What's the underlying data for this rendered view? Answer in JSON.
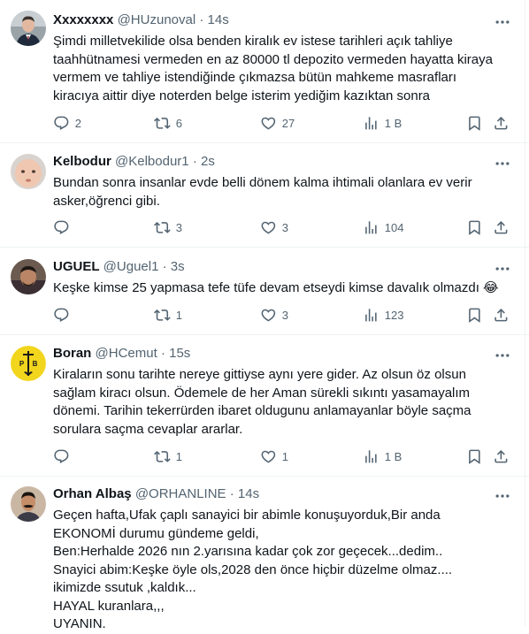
{
  "tweets": [
    {
      "name": "Xxxxxxxx",
      "handle": "@HUzunoval",
      "separator": "·",
      "time": "14s",
      "lines": [
        "Şimdi milletvekilide olsa benden kiralık ev istese tarihleri açık tahliye",
        "taahhütnamesi vermeden en az 80000 tl depozito vermeden hayatta kiraya",
        "vermem ve tahliye istendiğinde çıkmazsa bütün mahkeme masrafları",
        "kiracıya aittir diye noterden belge isterim yediğim kazıktan sonra"
      ],
      "replies": "2",
      "retweets": "6",
      "likes": "27",
      "views": "1 B",
      "avatar": "man-in-suit"
    },
    {
      "name": "Kelbodur",
      "handle": "@Kelbodur1",
      "separator": "·",
      "time": "2s",
      "lines": [
        "Bundan sonra insanlar evde belli dönem kalma ihtimali olanlara ev verir",
        "asker,öğrenci gibi."
      ],
      "replies": "",
      "retweets": "3",
      "likes": "3",
      "views": "104",
      "avatar": "baby"
    },
    {
      "name": "UGUEL",
      "handle": "@Uguel1",
      "separator": "·",
      "time": "3s",
      "lines": [
        "Keşke kimse 25 yapmasa tefe tüfe devam etseydi kimse davalık olmazdı 😂"
      ],
      "replies": "",
      "retweets": "1",
      "likes": "3",
      "views": "123",
      "avatar": "man-selfie"
    },
    {
      "name": "Boran",
      "handle": "@HCemut",
      "separator": "·",
      "time": "15s",
      "lines": [
        "Kiraların sonu tarihte nereye gittiyse aynı yere gider.  Az olsun öz olsun",
        "sağlam kiracı olsun. Ödemele de her Aman sürekli sıkıntı yasamayalım",
        "dönemi. Tarihin tekerrürden ibaret oldugunu anlamayanlar böyle saçma",
        "sorulara saçma cevaplar ararlar."
      ],
      "replies": "",
      "retweets": "1",
      "likes": "1",
      "views": "1 B",
      "avatar": "yellow-emblem",
      "avatar_letters": [
        "P",
        "B"
      ]
    },
    {
      "name": "Orhan Albaş",
      "handle": "@ORHANLINE",
      "separator": "·",
      "time": "14s",
      "lines": [
        "Geçen hafta,Ufak çaplı sanayici bir abimle konuşuyorduk,Bir anda",
        "EKONOMİ durumu gündeme geldi,",
        "Ben:Herhalde 2026 nın 2.yarısına kadar çok zor geçecek...dedim..",
        "Snayici abim:Keşke öyle ols,2028 den önce hiçbir düzelme olmaz....",
        "ikimizde ssutuk ,kaldık...",
        "HAYAL kuranlara,,,",
        "UYANIN."
      ],
      "avatar": "man-mustache"
    }
  ],
  "colors": {
    "text": "#0f1419",
    "muted": "#536471",
    "border": "#eff3f4"
  }
}
